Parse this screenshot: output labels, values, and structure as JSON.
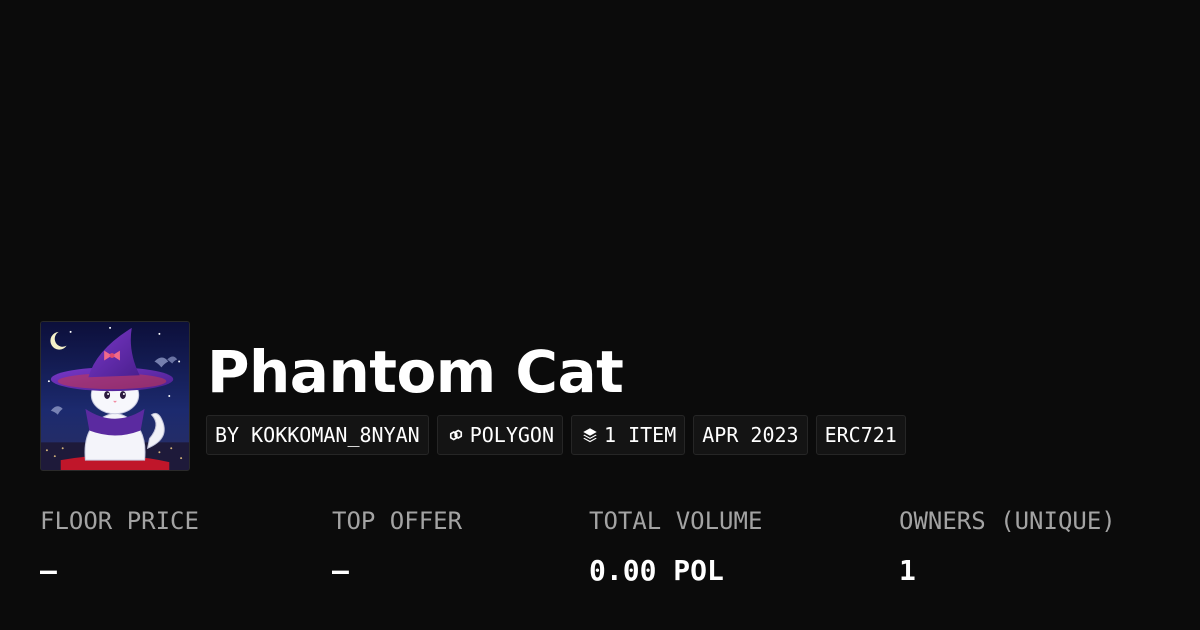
{
  "collection": {
    "name": "Phantom Cat",
    "avatar_description": "collection-avatar"
  },
  "tags": {
    "creator": "BY KOKKOMAN_8NYAN",
    "chain": "POLYGON",
    "chain_icon": "polygon-icon",
    "items": "1 ITEM",
    "items_icon": "layers-icon",
    "date": "APR 2023",
    "standard": "ERC721"
  },
  "stats": [
    {
      "label": "FLOOR PRICE",
      "value": "—"
    },
    {
      "label": "TOP OFFER",
      "value": "—"
    },
    {
      "label": "TOTAL VOLUME",
      "value": "0.00 POL"
    },
    {
      "label": "OWNERS (UNIQUE)",
      "value": "1"
    }
  ],
  "colors": {
    "background": "#0b0b0b",
    "text": "#ffffff",
    "muted_label": "#a3a3a3",
    "tag_background": "#141414",
    "tag_border": "#262626"
  }
}
